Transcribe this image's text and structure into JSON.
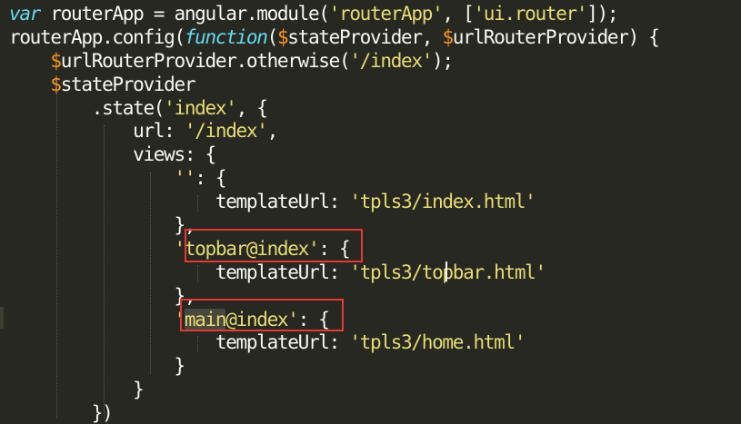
{
  "code_lines": [
    [
      {
        "t": "kw",
        "v": "var"
      },
      {
        "t": "plain",
        "v": " routerApp = angular.module("
      },
      {
        "t": "str",
        "v": "'routerApp'"
      },
      {
        "t": "plain",
        "v": ", ["
      },
      {
        "t": "str",
        "v": "'ui.router'"
      },
      {
        "t": "plain",
        "v": "]);"
      }
    ],
    [
      {
        "t": "plain",
        "v": "routerApp.config("
      },
      {
        "t": "kw",
        "v": "function"
      },
      {
        "t": "plain",
        "v": "("
      },
      {
        "t": "var",
        "v": "$"
      },
      {
        "t": "plain",
        "v": "stateProvider, "
      },
      {
        "t": "var",
        "v": "$"
      },
      {
        "t": "plain",
        "v": "urlRouterProvider) {"
      }
    ],
    [
      {
        "t": "plain",
        "v": "    "
      },
      {
        "t": "var",
        "v": "$"
      },
      {
        "t": "plain",
        "v": "urlRouterProvider.otherwise("
      },
      {
        "t": "str",
        "v": "'/index'"
      },
      {
        "t": "plain",
        "v": ");"
      }
    ],
    [
      {
        "t": "plain",
        "v": "    "
      },
      {
        "t": "var",
        "v": "$"
      },
      {
        "t": "plain",
        "v": "stateProvider"
      }
    ],
    [
      {
        "t": "plain",
        "v": "        .state("
      },
      {
        "t": "str",
        "v": "'index'"
      },
      {
        "t": "plain",
        "v": ", {"
      }
    ],
    [
      {
        "t": "plain",
        "v": "            url: "
      },
      {
        "t": "str",
        "v": "'/index'"
      },
      {
        "t": "plain",
        "v": ","
      }
    ],
    [
      {
        "t": "plain",
        "v": "            views: {"
      }
    ],
    [
      {
        "t": "plain",
        "v": "                "
      },
      {
        "t": "str",
        "v": "''"
      },
      {
        "t": "plain",
        "v": ": {"
      }
    ],
    [
      {
        "t": "plain",
        "v": "                    templateUrl: "
      },
      {
        "t": "str",
        "v": "'tpls3/index.html'"
      }
    ],
    [
      {
        "t": "plain",
        "v": "                },"
      }
    ],
    [
      {
        "t": "plain",
        "v": "                "
      },
      {
        "t": "str",
        "v": "'topbar@index'"
      },
      {
        "t": "plain",
        "v": ": {"
      }
    ],
    [
      {
        "t": "plain",
        "v": "                    templateUrl: "
      },
      {
        "t": "str",
        "v": "'tpls3/topbar.html'"
      }
    ],
    [
      {
        "t": "plain",
        "v": "                },"
      }
    ],
    [
      {
        "t": "plain",
        "v": "                "
      },
      {
        "t": "str",
        "v": "'main@index'"
      },
      {
        "t": "plain",
        "v": ": {"
      }
    ],
    [
      {
        "t": "plain",
        "v": "                    templateUrl: "
      },
      {
        "t": "str",
        "v": "'tpls3/home.html'"
      }
    ],
    [
      {
        "t": "plain",
        "v": "                }"
      }
    ],
    [
      {
        "t": "plain",
        "v": "            }"
      }
    ],
    [
      {
        "t": "plain",
        "v": "        })"
      }
    ]
  ],
  "highlighted_word": "main",
  "colors": {
    "background": "#272822",
    "keyword": "#66d9ef",
    "string": "#e6db74",
    "variable": "#fd971f",
    "plain": "#f8f8f2",
    "annotation_box": "#e53935"
  },
  "annotations": [
    {
      "target": "'topbar@index'"
    },
    {
      "target": "'main@index'"
    }
  ]
}
